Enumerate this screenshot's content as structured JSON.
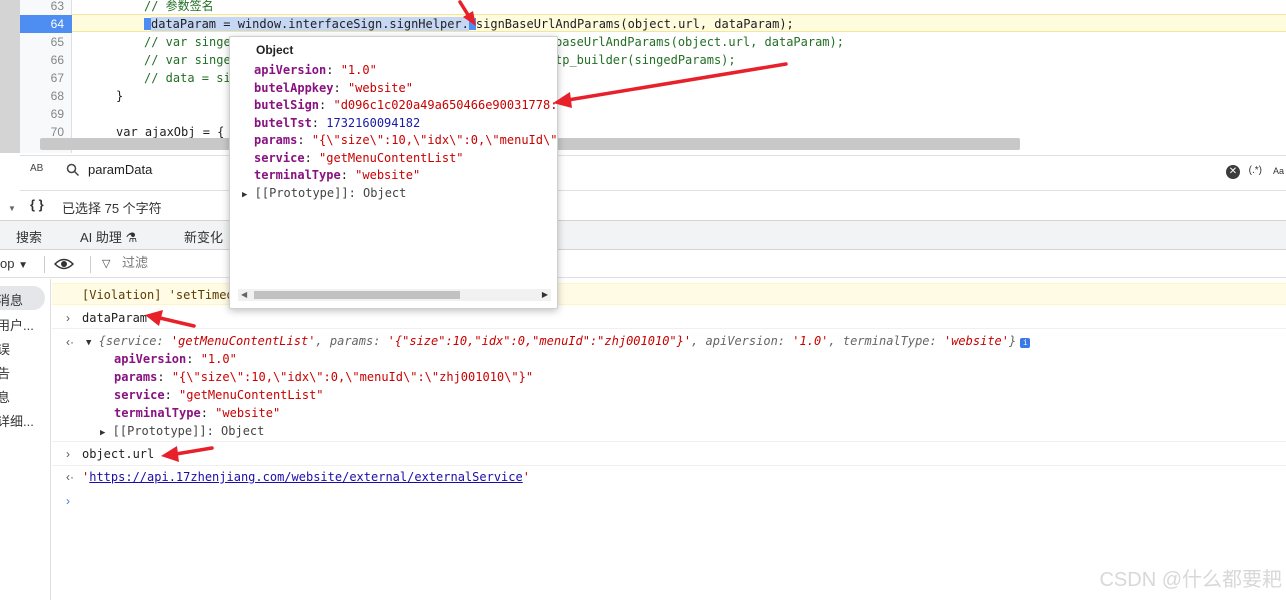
{
  "editor": {
    "lines": [
      {
        "no": "63",
        "text": "// 参数签名"
      },
      {
        "no": "64",
        "selected": "dataParam = window.interfaceSign.signHelper.",
        "rest": "signBaseUrlAndParams(object.url, dataParam);"
      },
      {
        "no": "65",
        "left": "// var singe",
        "right": "baseUrlAndParams(object.url, dataParam);"
      },
      {
        "no": "66",
        "left": "// var singe",
        "right": "tp_builder(singedParams);"
      },
      {
        "no": "67",
        "left": "// data = si",
        "right": ""
      },
      {
        "no": "68",
        "left": "}",
        "right": ""
      },
      {
        "no": "69",
        "left": "",
        "right": ""
      },
      {
        "no": "70",
        "left": "var ajaxObj = {",
        "right": ""
      }
    ]
  },
  "search": {
    "value": "paramData",
    "ab_icon": "AB",
    "regex_icon": "(.*)",
    "case_icon": "Aa"
  },
  "status": {
    "selection": "已选择 75 个字符"
  },
  "drawer": {
    "tabs": [
      "搜索",
      "AI 助理",
      "新变化"
    ]
  },
  "console_toolbar": {
    "context": "op",
    "filter_placeholder": "过滤"
  },
  "sidebar": {
    "items": [
      "消息",
      "用户...",
      "误",
      "告",
      "息",
      "详细..."
    ]
  },
  "popover": {
    "title": "Object",
    "rows": [
      {
        "key": "apiVersion",
        "value": "\"1.0\"",
        "type": "str"
      },
      {
        "key": "butelAppkey",
        "value": "\"website\"",
        "type": "str"
      },
      {
        "key": "butelSign",
        "value": "\"d096c1c020a49a650466e90031778:",
        "type": "str"
      },
      {
        "key": "butelTst",
        "value": "1732160094182",
        "type": "num"
      },
      {
        "key": "params",
        "value": "\"{\\\"size\\\":10,\\\"idx\\\":0,\\\"menuId\\\"",
        "type": "str"
      },
      {
        "key": "service",
        "value": "\"getMenuContentList\"",
        "type": "str"
      },
      {
        "key": "terminalType",
        "value": "\"website\"",
        "type": "str"
      }
    ],
    "prototype": "[[Prototype]]: Object"
  },
  "console": {
    "violation": "[Violation] 'setTimeo",
    "input1": "dataParam",
    "summary": "{service: 'getMenuContentList', params: '{\"size\":10,\"idx\":0,\"menuId\":\"zhj001010\"}', apiVersion: '1.0', terminalType: 'website'}",
    "summary_parts": {
      "open": "{",
      "k1": "service: ",
      "v1": "'getMenuContentList'",
      "k2": ", params: ",
      "v2": "'{\"size\":10,\"idx\":0,\"menuId\":\"zhj001010\"}'",
      "k3": ", apiVersion: ",
      "v3": "'1.0'",
      "k4": ", terminalType: ",
      "v4": "'website'",
      "close": "}"
    },
    "expanded": [
      {
        "key": "apiVersion",
        "value": "\"1.0\""
      },
      {
        "key": "params",
        "value": "\"{\\\"size\\\":10,\\\"idx\\\":0,\\\"menuId\\\":\\\"zhj001010\\\"}\""
      },
      {
        "key": "service",
        "value": "\"getMenuContentList\""
      },
      {
        "key": "terminalType",
        "value": "\"website\""
      }
    ],
    "prototype": "[[Prototype]]: Object",
    "input2": "object.url",
    "result_url": "https://api.17zhenjiang.com/website/external/externalService",
    "info_badge": "i"
  },
  "watermark": "CSDN @什么都要耙",
  "colors": {
    "selection": "#c5d7f4",
    "active_line": "#fffbdd",
    "gutter_active": "#4e8ef2",
    "annotation": "#e8202a",
    "string": "#c80000",
    "key": "#881280",
    "number": "#1a1aa6"
  }
}
